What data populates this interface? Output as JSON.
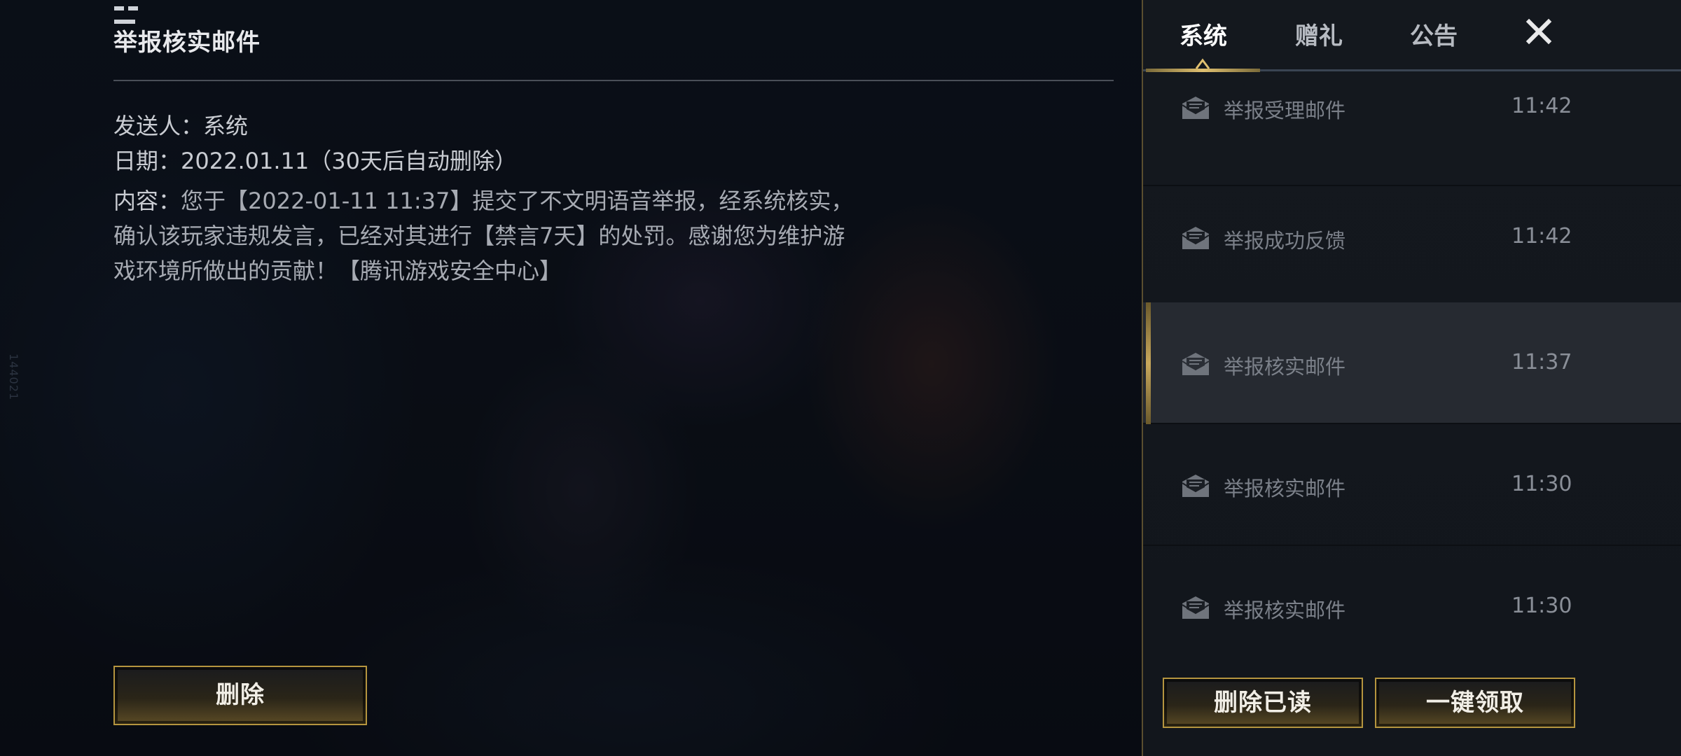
{
  "detail": {
    "title": "举报核实邮件",
    "sender_label": "发送人：",
    "sender": "系统",
    "date_label": "日期：",
    "date": "2022.01.11（30天后自动删除）",
    "content_label": "内容：",
    "content": "您于【2022-01-11 11:37】提交了不文明语音举报，经系统核实，确认该玩家违规发言，已经对其进行【禁言7天】的处罚。感谢您为维护游戏环境所做出的贡献！【腾讯游戏安全中心】",
    "delete_button": "删除"
  },
  "side_id": "144021",
  "tabs": [
    {
      "label": "系统",
      "active": true
    },
    {
      "label": "赠礼",
      "active": false
    },
    {
      "label": "公告",
      "active": false
    }
  ],
  "close_icon": "close-x-icon",
  "mails": [
    {
      "title": "举报受理邮件",
      "time": "11:42",
      "icon": "envelope-open-icon",
      "selected": false
    },
    {
      "title": "举报成功反馈",
      "time": "11:42",
      "icon": "envelope-open-icon",
      "selected": false
    },
    {
      "title": "举报核实邮件",
      "time": "11:37",
      "icon": "envelope-open-icon",
      "selected": true
    },
    {
      "title": "举报核实邮件",
      "time": "11:30",
      "icon": "envelope-open-icon",
      "selected": false
    },
    {
      "title": "举报核实邮件",
      "time": "11:30",
      "icon": "envelope-open-icon",
      "selected": false
    }
  ],
  "footer": {
    "delete_read": "删除已读",
    "claim_all": "一键领取"
  },
  "colors": {
    "gold_accent": "#c9a85c",
    "panel_bg": "#14181e",
    "selected_row": "#262a31"
  }
}
